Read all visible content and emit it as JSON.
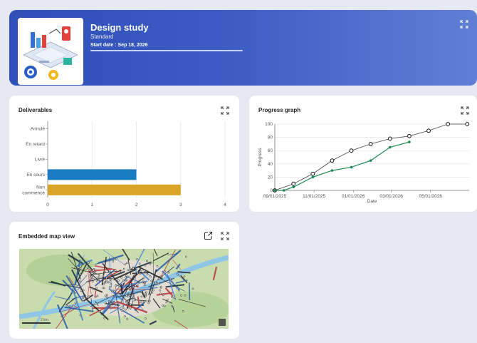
{
  "project": {
    "title": "Design study",
    "type": "Standard",
    "start_date": "Start date : Sep 18, 2026",
    "progress": 1.0
  },
  "deliverables_card": {
    "title": "Deliverables"
  },
  "progress_card": {
    "title": "Progress graph"
  },
  "map_card": {
    "title": "Embedded map view",
    "scale_label": "2 km"
  },
  "colors": {
    "hero": "#3a5cc4",
    "bar_blue": "#1a7cc2",
    "bar_gold": "#d9a326",
    "line_green": "#1e8a56"
  },
  "icons": {
    "expand": "expand-arrows-icon",
    "open": "open-external-icon"
  },
  "chart_data": [
    {
      "type": "bar",
      "orientation": "horizontal",
      "title": "Deliverables",
      "categories": [
        "Annulé",
        "En retard",
        "Livré",
        "En cours",
        "Non commencé"
      ],
      "category_lines": [
        [
          "Annulé"
        ],
        [
          "En retard"
        ],
        [
          "Livré"
        ],
        [
          "En cours"
        ],
        [
          "Non",
          "commencé"
        ]
      ],
      "values": [
        0,
        0,
        0,
        2,
        3
      ],
      "bar_colors": [
        "#1a7cc2",
        "#1a7cc2",
        "#1a7cc2",
        "#1a7cc2",
        "#d9a326"
      ],
      "xlim": [
        0,
        4
      ],
      "xticks": [
        "0",
        "1",
        "2",
        "3",
        "4"
      ],
      "grid": true
    },
    {
      "type": "line",
      "title": "Progress graph",
      "xlabel": "Date",
      "ylabel": "Progress",
      "ylim": [
        0,
        100
      ],
      "yticks": [
        "0",
        "20",
        "40",
        "60",
        "80",
        "100"
      ],
      "xticks": [
        "09/01/2025",
        "11/01/2025",
        "01/01/2026",
        "03/01/2026",
        "05/01/2026"
      ],
      "xlim": [
        "2025-09-01",
        "2026-06-30"
      ],
      "series": [
        {
          "name": "",
          "color": "#444444",
          "x": [
            "2025-09-01",
            "2025-09-30",
            "2025-10-30",
            "2025-11-29",
            "2025-12-29",
            "2026-01-28",
            "2026-02-27",
            "2026-03-29",
            "2026-04-28",
            "2026-05-28",
            "2026-06-27"
          ],
          "y": [
            0,
            10,
            25,
            45,
            60,
            70,
            78,
            82,
            90,
            100,
            100
          ]
        },
        {
          "name": "",
          "color": "#1e8a56",
          "x": [
            "2025-09-01",
            "2025-09-15",
            "2025-09-30",
            "2025-10-30",
            "2025-11-29",
            "2025-12-29",
            "2026-01-28",
            "2026-02-27",
            "2026-03-29"
          ],
          "y": [
            0,
            0,
            5,
            20,
            30,
            35,
            45,
            65,
            73
          ]
        }
      ]
    }
  ]
}
